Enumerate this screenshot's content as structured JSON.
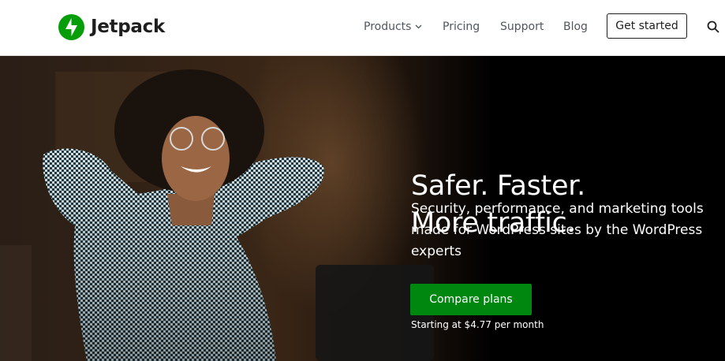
{
  "header": {
    "logo_text": "Jetpack",
    "nav": {
      "products": "Products",
      "pricing": "Pricing",
      "support": "Support",
      "blog": "Blog"
    },
    "cta_label": "Get started",
    "search_icon": "search-icon"
  },
  "hero": {
    "headline_line1": "Safer. Faster.",
    "headline_line2": "More traffic.",
    "subtitle": "Security, performance, and marketing tools made for WordPress sites by the WordPress experts",
    "cta_label": "Compare plans",
    "price_note": "Starting at $4.77 per month"
  },
  "colors": {
    "brand_green": "#069e08",
    "cta_green": "#008710",
    "hero_bg": "#000000",
    "nav_text": "#50575e"
  }
}
